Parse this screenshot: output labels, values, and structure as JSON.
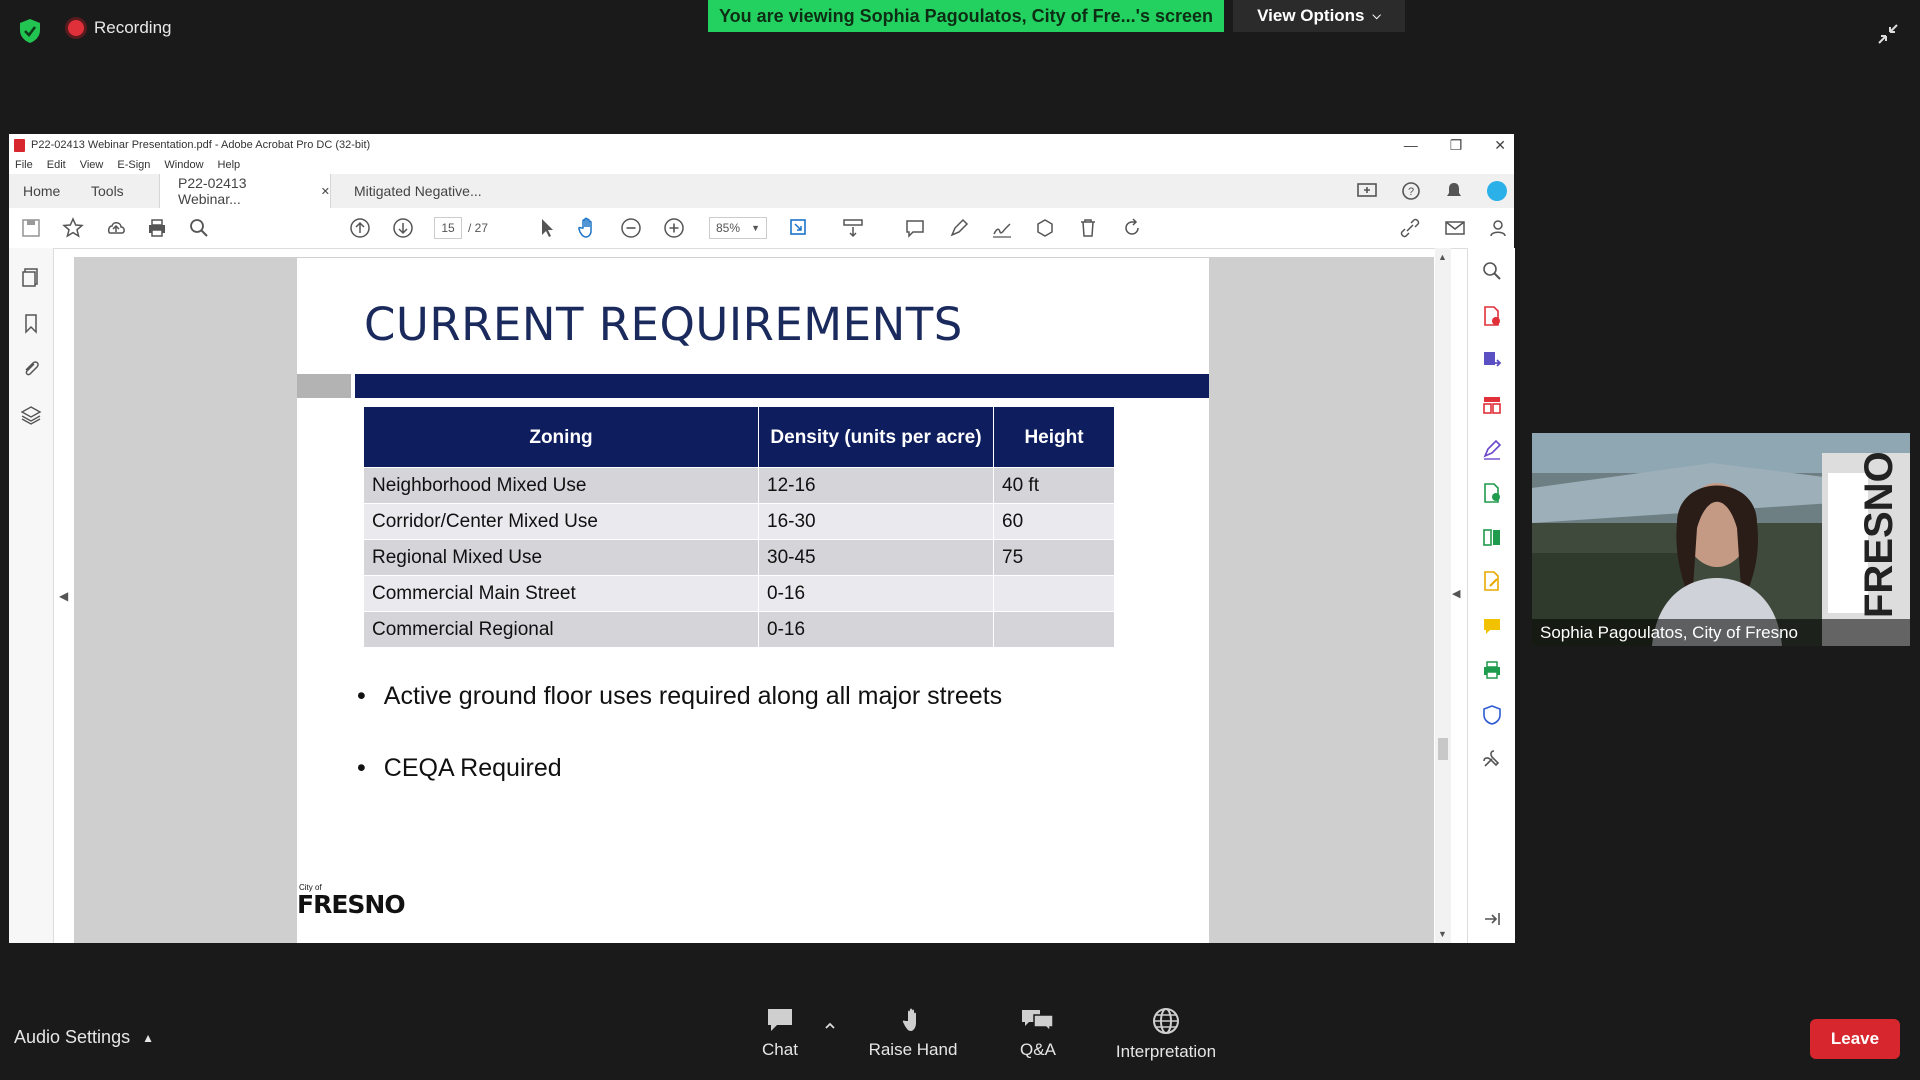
{
  "zoom": {
    "recording_label": "Recording",
    "banner_text": "You are viewing Sophia Pagoulatos, City of Fre...'s screen",
    "view_options_label": "View Options",
    "audio_settings_label": "Audio Settings",
    "bottom_buttons": {
      "chat": "Chat",
      "raise_hand": "Raise Hand",
      "qa": "Q&A",
      "interpretation": "Interpretation"
    },
    "leave_label": "Leave",
    "participant_name": "Sophia Pagoulatos, City of Fresno"
  },
  "acrobat": {
    "window_title": "P22-02413 Webinar Presentation.pdf - Adobe Acrobat Pro DC (32-bit)",
    "menu": [
      "File",
      "Edit",
      "View",
      "E-Sign",
      "Window",
      "Help"
    ],
    "tabs": {
      "home": "Home",
      "tools": "Tools",
      "doc1": "P22-02413 Webinar...",
      "doc2": "Mitigated Negative..."
    },
    "page_current": "15",
    "page_total": "/ 27",
    "zoom_level": "85%"
  },
  "slide": {
    "title": "CURRENT REQUIREMENTS",
    "table_headers": [
      "Zoning",
      "Density (units per acre)",
      "Height"
    ],
    "table_rows": [
      [
        "Neighborhood Mixed Use",
        "12-16",
        "40 ft"
      ],
      [
        "Corridor/Center Mixed Use",
        "16-30",
        "60"
      ],
      [
        "Regional Mixed Use",
        "30-45",
        "75"
      ],
      [
        "Commercial Main Street",
        "0-16",
        ""
      ],
      [
        "Commercial Regional",
        "0-16",
        ""
      ]
    ],
    "bullets": [
      "Active ground floor uses required along all major streets",
      "CEQA Required"
    ],
    "logo_small_text": "City of",
    "logo_text": "FRESNO"
  },
  "colors": {
    "banner": "#23d160",
    "leave": "#d7262d",
    "slide_navy": "#0d1d5e",
    "slide_title": "#1b2a5c"
  }
}
